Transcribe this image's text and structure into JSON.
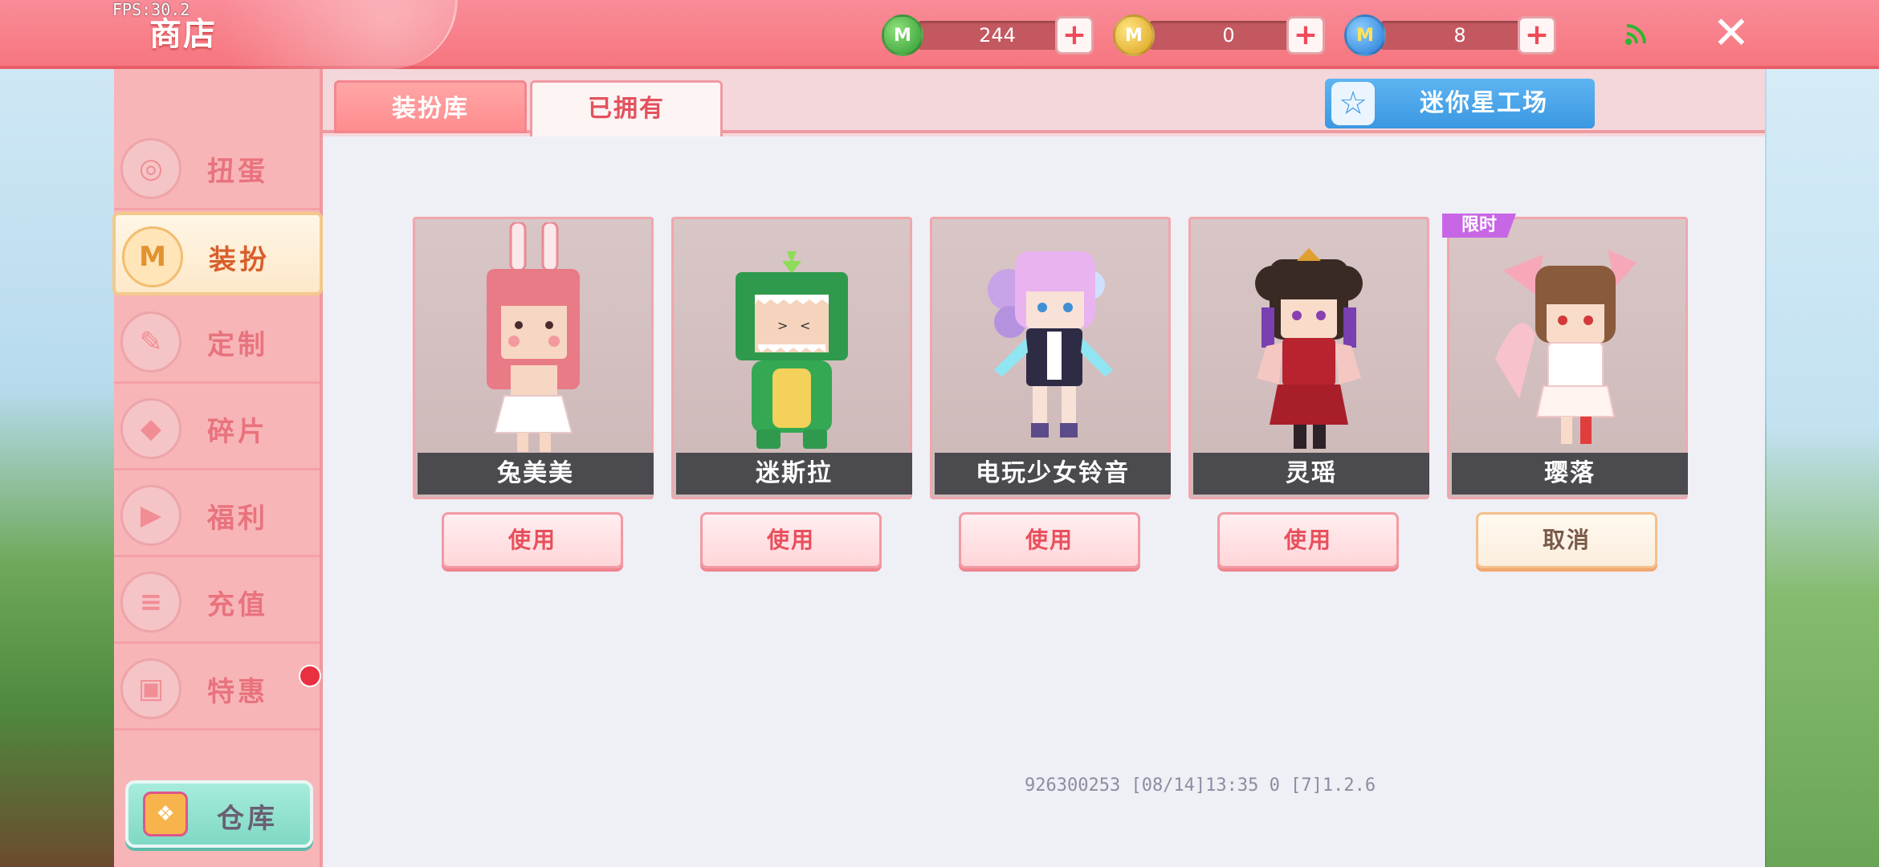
{
  "hud": {
    "fps": "FPS:30.2"
  },
  "header": {
    "title": "商店",
    "currencies": [
      {
        "icon": "green-m-coin-icon",
        "value": "244",
        "color": "#3aa83a"
      },
      {
        "icon": "gold-m-coin-icon",
        "value": "0",
        "color": "#e8b82a"
      },
      {
        "icon": "blue-m-coin-icon",
        "value": "8",
        "color": "#2e8be0"
      }
    ],
    "add_symbol": "+",
    "close_symbol": "✕"
  },
  "sidebar": {
    "items": [
      {
        "label": "扭蛋",
        "icon": "capsule-icon",
        "active": false
      },
      {
        "label": "装扮",
        "icon": "outfit-shirt-icon",
        "active": true
      },
      {
        "label": "定制",
        "icon": "custom-pencil-icon",
        "active": false
      },
      {
        "label": "碎片",
        "icon": "fragment-icon",
        "active": false
      },
      {
        "label": "福利",
        "icon": "gift-icon",
        "active": false
      },
      {
        "label": "充值",
        "icon": "recharge-coins-icon",
        "active": false
      },
      {
        "label": "特惠",
        "icon": "discount-box-icon",
        "active": false
      }
    ],
    "warehouse_label": "仓库"
  },
  "tabs": {
    "library": "装扮库",
    "owned": "已拥有",
    "workshop": "迷你星工场"
  },
  "outfits": [
    {
      "name": "兔美美",
      "button": "使用",
      "limited": false
    },
    {
      "name": "迷斯拉",
      "button": "使用",
      "limited": false
    },
    {
      "name": "电玩少女铃音",
      "button": "使用",
      "limited": false
    },
    {
      "name": "灵瑶",
      "button": "使用",
      "limited": false
    },
    {
      "name": "璎落",
      "button": "取消",
      "limited": true,
      "badge": "限时"
    }
  ],
  "footer": {
    "info": "926300253   [08/14]13:35 0   [7]1.2.6"
  }
}
